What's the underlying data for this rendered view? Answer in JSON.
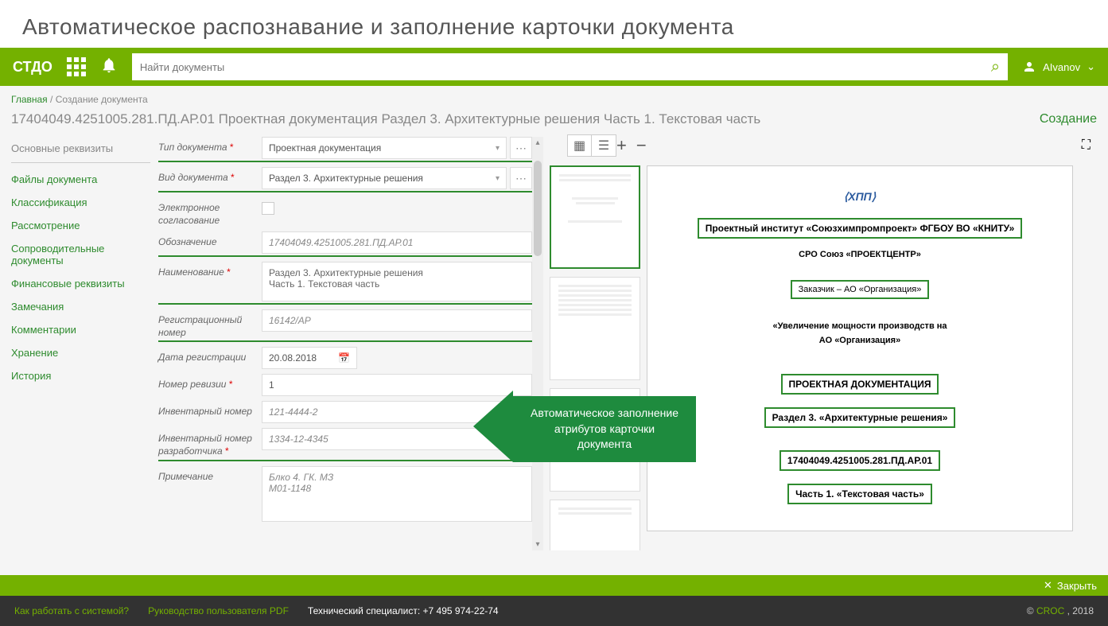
{
  "page_title": "Автоматическое распознавание и заполнение карточки документа",
  "header": {
    "logo": "СТДО",
    "search_placeholder": "Найти документы",
    "user": "AIvanov"
  },
  "breadcrumb": {
    "home": "Главная",
    "current": "Создание документа"
  },
  "doc_title": "17404049.4251005.281.ПД.АР.01 Проектная документация  Раздел 3. Архитектурные решения Часть 1. Текстовая часть",
  "status": "Создание",
  "sidebar": {
    "items": [
      "Основные реквизиты",
      "Файлы документа",
      "Классификация",
      "Рассмотрение",
      "Сопроводительные документы",
      "Финансовые реквизиты",
      "Замечания",
      "Комментарии",
      "Хранение",
      "История"
    ]
  },
  "form": {
    "type_label": "Тип документа",
    "type_value": "Проектная документация",
    "kind_label": "Вид документа",
    "kind_value": "Раздел 3. Архитектурные решения",
    "eapprove_label": "Электронное согласование",
    "code_label": "Обозначение",
    "code_value": "17404049.4251005.281.ПД.АР.01",
    "name_label": "Наименование",
    "name_value": "Раздел 3. Архитектурные решения\nЧасть 1. Текстовая часть",
    "regnum_label": "Регистрационный номер",
    "regnum_value": "16142/АР",
    "regdate_label": "Дата регистрации",
    "regdate_value": "20.08.2018",
    "rev_label": "Номер ревизии",
    "rev_value": "1",
    "inv_label": "Инвентарный номер",
    "inv_value": "121-4444-2",
    "invdev_label": "Инвентарный номер разработчика",
    "invdev_value": "1334-12-4345",
    "note_label": "Примечание",
    "note_value": "Блко 4. ГК. МЗ\nМ01-1148"
  },
  "callout": "Автоматическое заполнение атрибутов карточки документа",
  "preview": {
    "org1": "Проектный институт «Союзхимпромпроект» ФГБОУ ВО «КНИТУ»",
    "org2": "СРО Союз «ПРОЕКТЦЕНТР»",
    "customer": "Заказчик – АО «Организация»",
    "title1": "«Увеличение мощности производств на",
    "title2": "АО «Организация»",
    "doctype": "ПРОЕКТНАЯ ДОКУМЕНТАЦИЯ",
    "section": "Раздел 3. «Архитектурные решения»",
    "code": "17404049.4251005.281.ПД.АР.01",
    "part": "Часть 1. «Текстовая часть»"
  },
  "close_label": "Закрыть",
  "footer": {
    "howto": "Как работать с системой?",
    "manual": "Руководство пользователя PDF",
    "support": "Технический специалист: +7 495 974-22-74",
    "copy_prefix": "© ",
    "croc": "CROC",
    "copy_suffix": " , 2018"
  }
}
